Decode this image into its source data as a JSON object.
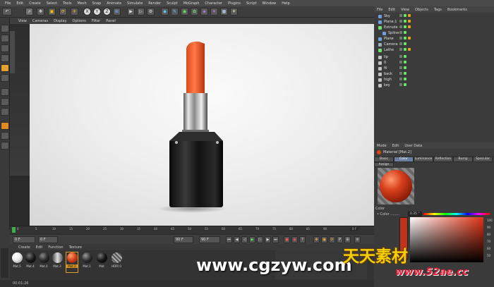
{
  "menubar": [
    "File",
    "Edit",
    "Create",
    "Select",
    "Tools",
    "Mesh",
    "Snap",
    "Animate",
    "Simulate",
    "Render",
    "Sculpt",
    "MoGraph",
    "Character",
    "Plugins",
    "Script",
    "Window",
    "Help"
  ],
  "toolbar": {
    "icons": [
      "undo-icon",
      "pointer-icon",
      "move-icon",
      "scale-icon",
      "rotate-icon",
      "x-axis-icon",
      "y-axis-icon",
      "z-axis-icon",
      "world-icon",
      "render-icon",
      "render-view-icon",
      "render-settings-icon",
      "cube-icon",
      "pen-icon",
      "subdivide-icon",
      "array-icon",
      "deformer-icon",
      "scene-icon",
      "camera-icon",
      "light-icon"
    ],
    "axis_labels": [
      "X",
      "Y",
      "Z"
    ]
  },
  "viewport": {
    "menu": [
      "View",
      "Cameras",
      "Display",
      "Options",
      "Filter",
      "Panel"
    ]
  },
  "timeline": {
    "ticks": [
      "0",
      "5",
      "10",
      "15",
      "20",
      "25",
      "30",
      "35",
      "40",
      "45",
      "50",
      "55",
      "60",
      "65",
      "70",
      "75",
      "80",
      "85",
      "90"
    ],
    "end_field": "0 F"
  },
  "transport": {
    "start_field": "0 F",
    "current_field": "0 F",
    "end_field": "90 F",
    "end_field2": "90 F"
  },
  "material_manager": {
    "menu": [
      "Create",
      "Edit",
      "Function",
      "Texture"
    ],
    "materials": [
      {
        "label": "Mat.5",
        "color": "#f0f0f0"
      },
      {
        "label": "Mat.4",
        "color": "#1a1a1a"
      },
      {
        "label": "Mat.4",
        "color": "#2a2a2a"
      },
      {
        "label": "Mat.3",
        "color": "#7a7a7a"
      },
      {
        "label": "Mat.2",
        "color": "#d8451c"
      },
      {
        "label": "Mat.1",
        "color": "#303030"
      },
      {
        "label": "Mat",
        "color": "#151515"
      },
      {
        "label": "HDRI 0",
        "color": "#8a8a8a"
      }
    ]
  },
  "status": {
    "time": "00:01:26"
  },
  "objects": {
    "menu": [
      "File",
      "Edit",
      "View",
      "Objects",
      "Tags",
      "Bookmarks"
    ],
    "rows": [
      {
        "name": "Sky",
        "color": "#6ea0e0"
      },
      {
        "name": "Plane.1",
        "color": "#6ea0e0"
      },
      {
        "name": "Extrude",
        "color": "#6ee06e"
      },
      {
        "name": "Spline",
        "color": "#6ea0e0"
      },
      {
        "name": "Plane",
        "color": "#6ea0e0"
      },
      {
        "name": "Camera",
        "color": "#9ab0c0"
      },
      {
        "name": "Lathe",
        "color": "#6ee06e"
      },
      {
        "name": "lip",
        "color": "#c0c0c0"
      },
      {
        "name": "0",
        "color": "#c0c0c0"
      },
      {
        "name": "fil",
        "color": "#c0c0c0"
      },
      {
        "name": "back",
        "color": "#c0c0c0"
      },
      {
        "name": "high",
        "color": "#c0c0c0"
      },
      {
        "name": "key",
        "color": "#c0c0c0"
      }
    ]
  },
  "attributes": {
    "menu": [
      "Mode",
      "Edit",
      "User Data"
    ],
    "title": "Material [Mat.2]",
    "tabs": [
      "Basic",
      "Color",
      "Luminance",
      "Reflection",
      "Bump",
      "Specular"
    ],
    "active_tab": "Color",
    "assign": "Assign",
    "color_section": "Color",
    "color_label": "• Color ........",
    "color_value": "0.35 °",
    "picker_values": [
      "100",
      "90",
      "80",
      "70",
      "60",
      "50"
    ],
    "swatch_color": "#c1321a"
  },
  "watermarks": {
    "site1": "www.cgzyw.com",
    "site2_cn": "天天素材",
    "site3": "www.52ae.cc"
  }
}
